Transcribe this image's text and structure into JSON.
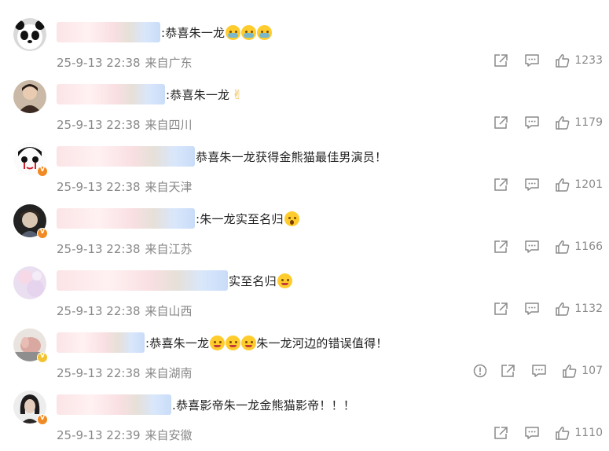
{
  "comments": [
    {
      "text": ":恭喜朱一龙",
      "emojis": [
        "cry",
        "cry",
        "cry"
      ],
      "date": "25-9-13 22:38",
      "location": "来自广东",
      "likes": "1233",
      "badge": "none",
      "blur_w": 132,
      "avatar": "panda"
    },
    {
      "text": ":恭喜朱一龙",
      "emojis": [],
      "victory": "✌",
      "date": "25-9-13 22:38",
      "location": "来自四川",
      "likes": "1179",
      "badge": "none",
      "blur_w": 138,
      "avatar": "man1"
    },
    {
      "text": "恭喜朱一龙获得金熊猫最佳男演员！",
      "emojis": [],
      "date": "25-9-13 22:38",
      "location": "来自天津",
      "likes": "1201",
      "badge": "orange",
      "blur_w": 176,
      "avatar": "cartoon"
    },
    {
      "text": ":朱一龙实至名归",
      "emojis": [
        "shock"
      ],
      "date": "25-9-13 22:38",
      "location": "来自江苏",
      "likes": "1166",
      "badge": "orange",
      "blur_w": 176,
      "avatar": "man2"
    },
    {
      "text": "实至名归",
      "emojis": [
        "love"
      ],
      "date": "25-9-13 22:38",
      "location": "来自山西",
      "likes": "1132",
      "badge": "none",
      "blur_w": 218,
      "avatar": "pink"
    },
    {
      "text": ":恭喜朱一龙",
      "text2": "朱一龙河边的错误值得！",
      "emojis": [
        "love",
        "love",
        "love"
      ],
      "date": "25-9-13 22:38",
      "location": "来自湖南",
      "likes": "107",
      "badge": "yellow",
      "blur_w": 112,
      "avatar": "hand",
      "report": true
    },
    {
      "text": ".恭喜影帝朱一龙金熊猫影帝！！！",
      "emojis": [],
      "date": "25-9-13 22:39",
      "location": "来自安徽",
      "likes": "1110",
      "badge": "orange",
      "blur_w": 146,
      "avatar": "woman"
    }
  ],
  "icons": {
    "share": "share-icon",
    "reply": "comment-icon",
    "like": "thumbs-up-icon",
    "report": "report-icon"
  },
  "colors": {
    "meta": "#888888",
    "badge_orange": "#f08a24",
    "badge_yellow": "#f2c230"
  }
}
